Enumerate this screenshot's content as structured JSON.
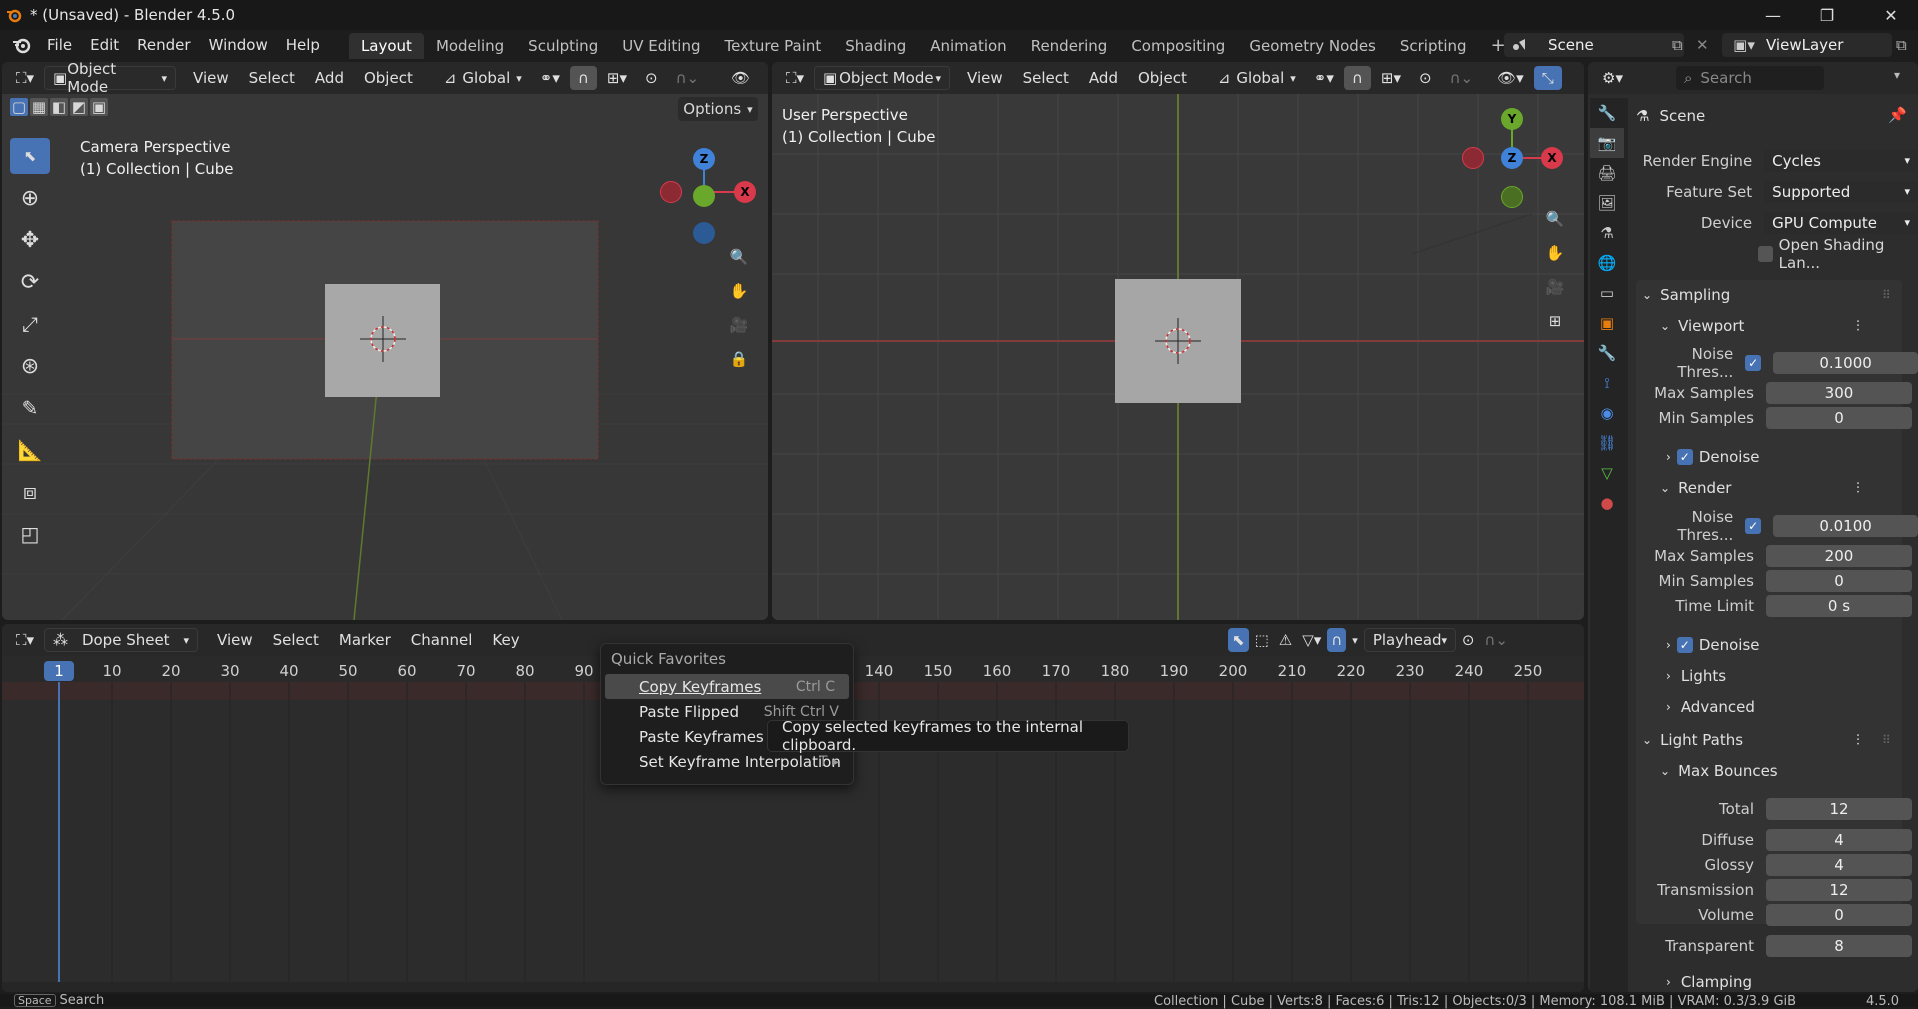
{
  "window": {
    "title": "* (Unsaved) - Blender 4.5.0",
    "minimize": "—",
    "maximize": "❐",
    "close": "✕"
  },
  "menubar": {
    "items": [
      "File",
      "Edit",
      "Render",
      "Window",
      "Help"
    ]
  },
  "workspaces": {
    "tabs": [
      "Layout",
      "Modeling",
      "Sculpting",
      "UV Editing",
      "Texture Paint",
      "Shading",
      "Animation",
      "Rendering",
      "Compositing",
      "Geometry Nodes",
      "Scripting"
    ],
    "active": "Layout",
    "add": "+"
  },
  "scene": {
    "name": "Scene",
    "view_layer": "ViewLayer"
  },
  "viewport_left": {
    "mode": "Object Mode",
    "menus": [
      "View",
      "Select",
      "Add",
      "Object"
    ],
    "orientation": "Global",
    "options": "Options",
    "overlay_line1": "Camera Perspective",
    "overlay_line2": "(1) Collection | Cube",
    "gizmo": {
      "z": "Z",
      "x": "X"
    }
  },
  "viewport_right": {
    "mode": "Object Mode",
    "menus": [
      "View",
      "Select",
      "Add",
      "Object"
    ],
    "orientation": "Global",
    "overlay_line1": "User Perspective",
    "overlay_line2": "(1) Collection | Cube",
    "gizmo": {
      "y": "Y",
      "z": "Z",
      "x": "X"
    }
  },
  "dopesheet": {
    "editor": "Dope Sheet",
    "menus": [
      "View",
      "Select",
      "Marker",
      "Channel",
      "Key"
    ],
    "playhead": "Playhead",
    "current_frame": "1",
    "frames": [
      "10",
      "20",
      "30",
      "40",
      "50",
      "60",
      "70",
      "80",
      "90",
      "140",
      "150",
      "160",
      "170",
      "180",
      "190",
      "200",
      "210",
      "220",
      "230",
      "240",
      "250"
    ]
  },
  "quick_favorites": {
    "title": "Quick Favorites",
    "items": [
      {
        "label": "Copy Keyframes",
        "shortcut": "Ctrl C"
      },
      {
        "label": "Paste Flipped",
        "shortcut": "Shift Ctrl V"
      },
      {
        "label": "Paste Keyframes",
        "shortcut": ""
      },
      {
        "label": "Set Keyframe Interpolation",
        "shortcut": "T ▸"
      }
    ],
    "tooltip": "Copy selected keyframes to the internal clipboard."
  },
  "properties": {
    "search_placeholder": "Search",
    "context": "Scene",
    "render_engine_label": "Render Engine",
    "render_engine": "Cycles",
    "feature_set_label": "Feature Set",
    "feature_set": "Supported",
    "device_label": "Device",
    "device": "GPU Compute",
    "osl": "Open Shading Lan...",
    "sampling": "Sampling",
    "viewport": "Viewport",
    "render": "Render",
    "noise_label": "Noise Thres...",
    "vp_noise": "0.1000",
    "max_samples_label": "Max Samples",
    "vp_max_samples": "300",
    "min_samples_label": "Min Samples",
    "vp_min_samples": "0",
    "denoise": "Denoise",
    "r_noise": "0.0100",
    "r_max_samples": "200",
    "r_min_samples": "0",
    "time_limit_label": "Time Limit",
    "time_limit": "0 s",
    "lights": "Lights",
    "advanced": "Advanced",
    "light_paths": "Light Paths",
    "max_bounces": "Max Bounces",
    "total_label": "Total",
    "total": "12",
    "diffuse_label": "Diffuse",
    "diffuse": "4",
    "glossy_label": "Glossy",
    "glossy": "4",
    "transmission_label": "Transmission",
    "transmission": "12",
    "volume_label": "Volume",
    "volume": "0",
    "transparent_label": "Transparent",
    "transparent": "8",
    "clamping": "Clamping"
  },
  "statusbar": {
    "space": "Space",
    "search": "Search",
    "stats": "Collection | Cube | Verts:8 | Faces:6 | Tris:12 | Objects:0/3 | Memory: 108.1 MiB | VRAM: 0.3/3.9 GiB",
    "version": "4.5.0"
  }
}
